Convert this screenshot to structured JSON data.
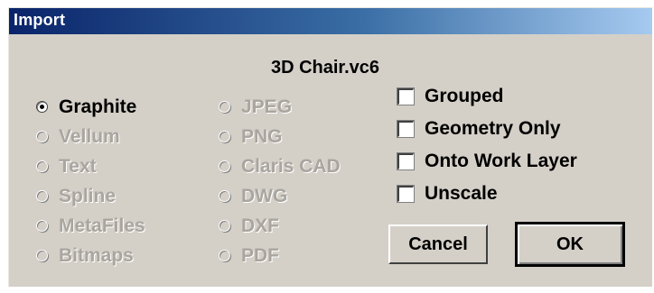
{
  "window": {
    "title": "Import"
  },
  "file": {
    "name": "3D Chair.vc6"
  },
  "formats_left": [
    {
      "label": "Graphite",
      "enabled": true,
      "selected": true
    },
    {
      "label": "Vellum",
      "enabled": false,
      "selected": false
    },
    {
      "label": "Text",
      "enabled": false,
      "selected": false
    },
    {
      "label": "Spline",
      "enabled": false,
      "selected": false
    },
    {
      "label": "MetaFiles",
      "enabled": false,
      "selected": false
    },
    {
      "label": "Bitmaps",
      "enabled": false,
      "selected": false
    }
  ],
  "formats_right": [
    {
      "label": "JPEG",
      "enabled": false,
      "selected": false
    },
    {
      "label": "PNG",
      "enabled": false,
      "selected": false
    },
    {
      "label": "Claris CAD",
      "enabled": false,
      "selected": false
    },
    {
      "label": "DWG",
      "enabled": false,
      "selected": false
    },
    {
      "label": "DXF",
      "enabled": false,
      "selected": false
    },
    {
      "label": "PDF",
      "enabled": false,
      "selected": false
    }
  ],
  "options": [
    {
      "label": "Grouped",
      "checked": false
    },
    {
      "label": "Geometry Only",
      "checked": false
    },
    {
      "label": "Onto Work Layer",
      "checked": false
    },
    {
      "label": "Unscale",
      "checked": false
    }
  ],
  "buttons": {
    "cancel": "Cancel",
    "ok": "OK"
  }
}
